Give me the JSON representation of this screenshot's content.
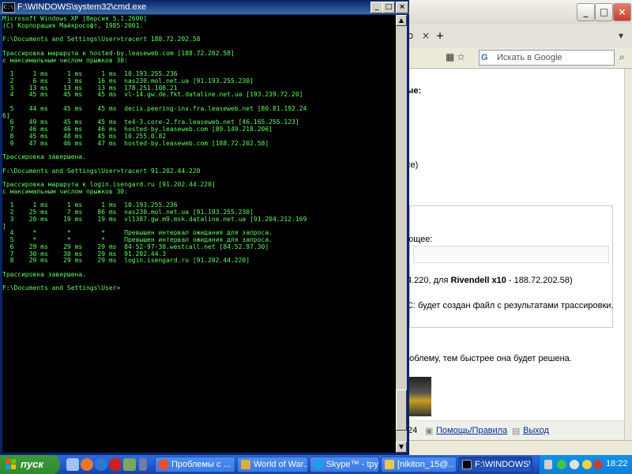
{
  "cmd": {
    "title": "F:\\WINDOWS\\system32\\cmd.exe",
    "lines": [
      "Microsoft Windows XP [Версия 5.1.2600]",
      "(С) Корпорация Майкрософт, 1985-2001.",
      "",
      "F:\\Documents and Settings\\User>tracert 188.72.202.58",
      "",
      "Трассировка маршрута к hosted-by.leaseweb.com [188.72.202.58]",
      "с максимальным числом прыжков 30:",
      "",
      "  1     1 ms     1 ms     1 ms  10.193.255.236",
      "  2     6 ms     3 ms    16 ms  nas230.mol.net.ua [91.193.255.230]",
      "  3    13 ms    13 ms    13 ms  178.251.108.21",
      "  4    45 ms    45 ms    45 ms  vl-14.gw.de.fkt.dataline.net.ua [193.239.72.20]",
      "",
      "  5    44 ms    45 ms    45 ms  decix.peering-inx.fra.leaseweb.net [80.81.192.24",
      "6]",
      "  6    49 ms    45 ms    45 ms  te4-3.core-2.fra.leaseweb.net [46.165.255.123]",
      "  7    46 ms    46 ms    46 ms  hosted-by.leaseweb.com [89.149.218.206]",
      "  8    45 ms    48 ms    45 ms  10.255.0.82",
      "  9    47 ms    46 ms    47 ms  hosted-by.leaseweb.com [188.72.202.58]",
      "",
      "Трассировка завершена.",
      "",
      "F:\\Documents and Settings\\User>tracert 91.202.44.220",
      "",
      "Трассировка маршрута к login.isengard.ru [91.202.44.220]",
      "с максимальным числом прыжков 30:",
      "",
      "  1     1 ms     1 ms     1 ms  10.193.255.236",
      "  2    25 ms     7 ms    86 ms  nas230.mol.net.ua [91.193.255.230]",
      "  3    20 ms    19 ms    19 ms  vl1387.gw.m9.msk.dataline.net.ua [91.204.212.169",
      "]",
      "  4     *        *        *     Превышен интервал ожидания для запроса.",
      "  5     *        *        *     Превышен интервал ожидания для запроса.",
      "  6    29 ms    29 ms    29 ms  84-52-97-30.westcall.net [84.52.97.30]",
      "  7    30 ms    30 ms    29 ms  91.202.44.3",
      "  8    29 ms    29 ms    29 ms  login.isengard.ru [91.202.44.220]",
      "",
      "Трассировка завершена.",
      "",
      "F:\\Documents and Settings\\User>"
    ]
  },
  "browser": {
    "search_placeholder": "Искать в Google",
    "content": {
      "heading_fragment": "ые:",
      "paren_fragment": "ce)",
      "next_fragment": "ющее:",
      "trace_line_prefix": "4.220, для ",
      "trace_line_bold": "Rivendell x10",
      "trace_line_suffix": " - 188.72.202.58)",
      "file_note": "C: будет создан файл с результатами трассировки.",
      "help_note": "роблему, тем быстрее она будет решена.",
      "footer_num": "24",
      "help_link": "Помощь/Правила",
      "logout_link": "Выход"
    }
  },
  "taskbar": {
    "start_label": "пуск",
    "tasks": [
      {
        "label": "Проблемы с ..."
      },
      {
        "label": "World of War..."
      },
      {
        "label": "Skype™ - tpy..."
      },
      {
        "label": "[nikiton_15@..."
      },
      {
        "label": "F:\\WINDOWS\\..."
      }
    ],
    "clock": "18:22"
  },
  "colors": {
    "console_text": "#5cff5c",
    "console_bg": "#000000",
    "titlebar": "#0a246a",
    "taskbar": "#245edb",
    "start": "#3c9a3c"
  }
}
